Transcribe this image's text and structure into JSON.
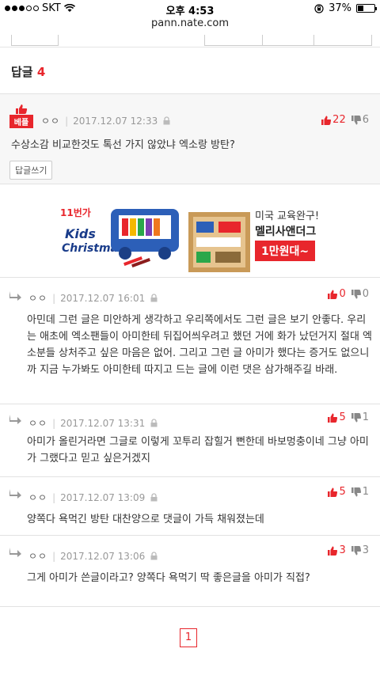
{
  "status_bar": {
    "carrier": "SKT",
    "time": "오후 4:53",
    "battery": "37%",
    "battery_level": 0.37
  },
  "browser": {
    "url": "pann.nate.com"
  },
  "replies_header": {
    "label": "답글",
    "count": "4"
  },
  "best_comment": {
    "badge": "베플",
    "author": "ㅇㅇ",
    "date": "2017.12.07 12:33",
    "text": "수상소감 비교한것도 톡선 가지 않았냐 엑소랑 방탄?",
    "up": "22",
    "down": "6",
    "reply_button": "답글쓰기"
  },
  "ad": {
    "brand": "11번가",
    "headline_a": "Kids",
    "headline_b": "Christmas",
    "line1": "미국 교육완구!",
    "line2": "멜리사앤더그",
    "price": "1만원대~"
  },
  "comments": [
    {
      "author": "ㅇㅇ",
      "date": "2017.12.07 16:01",
      "up": "0",
      "down": "0",
      "text": "아민데 그런 글은 미안하게 생각하고 우리쪽에서도 그런 글은 보기 안좋다. 우리는 애초에 엑소팬들이 아미한테 뒤집어씌우려고 했던 거에 화가 났던거지 절대 엑소분들 상처주고 싶은 마음은 없어. 그리고 그런 글 아미가 했다는 증거도 없으니까 지금 누가봐도 아미한테 따지고 드는 글에 이런 댓은 삼가해주길 바래."
    },
    {
      "author": "ㅇㅇ",
      "date": "2017.12.07 13:31",
      "up": "5",
      "down": "1",
      "text": "아미가 올린거라면 그글로 이렇게 꼬투리 잡힐거 뻔한데 바보멍충이네 그냥 아미가 그랬다고 믿고 싶은거겠지"
    },
    {
      "author": "ㅇㅇ",
      "date": "2017.12.07 13:09",
      "up": "5",
      "down": "1",
      "text": "양쪽다 욕먹긴 방탄 대찬양으로 댓글이 가득 채워졌는데"
    },
    {
      "author": "ㅇㅇ",
      "date": "2017.12.07 13:06",
      "up": "3",
      "down": "3",
      "text": "그게 아미가 쓴글이라고? 양쪽다 욕먹기 딱 좋은글을 아미가 직접?"
    }
  ],
  "pagination": {
    "current": "1"
  },
  "colors": {
    "accent": "#e8262c",
    "muted": "#999999"
  }
}
